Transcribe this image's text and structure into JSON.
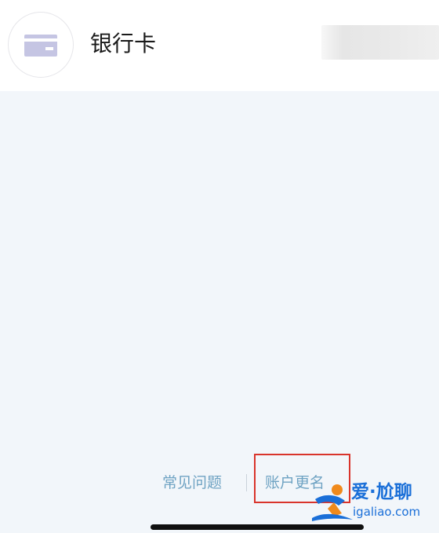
{
  "header": {
    "title": "银行卡",
    "icon": "bank-card-icon"
  },
  "footer": {
    "faq_label": "常见问题",
    "rename_label": "账户更名"
  },
  "watermark": {
    "text": "爱·尬聊",
    "domain": "igaliao.com"
  },
  "colors": {
    "background": "#f2f6fa",
    "link": "#6fa3c3",
    "highlight": "#d9342b",
    "watermark": "#1a6fd8"
  }
}
